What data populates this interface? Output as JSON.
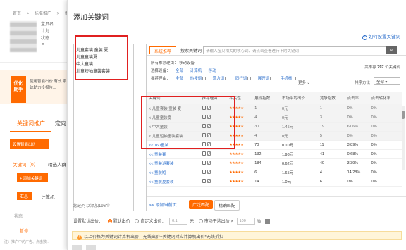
{
  "background": {
    "breadcrumb": [
      "首页",
      ">",
      "标准推广",
      ">",
      "推广"
    ],
    "info_lines": [
      "宝贝名：",
      "计划：",
      "状态：",
      "日："
    ],
    "promo_title": "优化助手",
    "promo_text": "使用智能出价 有效 系统助力投报告...",
    "tab_active": "关键词推广",
    "tab_other": "定向",
    "smart_btn": "设置智能出价",
    "kw_tab": "关键词（0）",
    "kw_tab_other": "精选人群",
    "add_kw_btn": "+ 添加关键词",
    "summary_btn": "汇总",
    "bid_label": "计算机",
    "status_label": "状态",
    "pause_label": "暂停",
    "note": "注：推广中的广告、点击数..."
  },
  "modal": {
    "title": "添加关键词",
    "help": "如何设置关键词",
    "selected_keywords": [
      "儿童套装 童装 夏",
      "儿童童装夏",
      "中大童装",
      "儿童短袖童装套装"
    ],
    "left_footer": "您还可以添加196个",
    "tabs": {
      "active": "系统推荐",
      "other": "搜索关键词"
    },
    "search_placeholder": "请输入宝贝相关的核心词、请点击查看进行下的关键词",
    "recommend_total_prefix": "共推荐",
    "recommend_total_count": "797",
    "recommend_total_suffix": "个关键词",
    "filters": {
      "all_reason_label": "所有推荐理由：",
      "all_reason_value": "移动设备",
      "device_label": "选择设备：",
      "device_options": [
        "全部",
        "计算机",
        "移动"
      ],
      "reason_label": "推荐理由：",
      "reason_options": [
        "全部",
        "热搜词",
        "潜力词",
        "同行词",
        "展开词",
        "手机标"
      ],
      "more": "更多",
      "sort_label": "排序方法：",
      "sort_value": "全部"
    },
    "table": {
      "headers": [
        "关键词",
        "推荐理由",
        "相关性",
        "展现指数",
        "市场平均出价",
        "竞争指数",
        "点击率",
        "点击转化率"
      ],
      "rows": [
        {
          "kw": "< 儿童套装 童装 夏",
          "stars": "★★★★★",
          "impr": "1",
          "avg": "0元",
          "comp": "1",
          "ctr": "0%",
          "cvr": "0%",
          "added": true
        },
        {
          "kw": "< 儿童童装夏",
          "stars": "★★★★★",
          "impr": "4",
          "avg": "0元",
          "comp": "3",
          "ctr": "0%",
          "cvr": "0%",
          "added": true
        },
        {
          "kw": "< 中大童装",
          "stars": "★★★★★",
          "impr": "30",
          "avg": "1.45元",
          "comp": "19",
          "ctr": "6.06%",
          "cvr": "0%",
          "added": true
        },
        {
          "kw": "< 儿童短袖童装套装",
          "stars": "★★★★★",
          "impr": "4",
          "avg": "0元",
          "comp": "5",
          "ctr": "0%",
          "cvr": "0%",
          "added": true
        },
        {
          "kw": "<< 160童装",
          "stars": "★★★★★",
          "impr": "70",
          "avg": "0.10元",
          "comp": "11",
          "ctr": "3.89%",
          "cvr": "0%",
          "added": false
        },
        {
          "kw": "<< 童装套",
          "stars": "★★★★★",
          "impr": "132",
          "avg": "1.98元",
          "comp": "41",
          "ctr": "0.68%",
          "cvr": "0%",
          "added": false
        },
        {
          "kw": "<< 童装运套装",
          "stars": "★★★★★",
          "impr": "184",
          "avg": "0.62元",
          "comp": "40",
          "ctr": "3.39%",
          "cvr": "0%",
          "added": false
        },
        {
          "kw": "<< 童装短",
          "stars": "★★★★★",
          "impr": "6",
          "avg": "1.65元",
          "comp": "4",
          "ctr": "14.28%",
          "cvr": "0%",
          "added": false
        },
        {
          "kw": "<< 童装夏套装",
          "stars": "★★★★★",
          "impr": "14",
          "avg": "1.0元",
          "comp": "6",
          "ctr": "0%",
          "cvr": "0%",
          "added": false
        }
      ]
    },
    "bottom": {
      "add_page": "<< 添加当前页",
      "btn_wide": "广泛匹配",
      "btn_exact": "精确匹配"
    },
    "bid": {
      "label": "设置默认出价：",
      "opt1": "默认出价",
      "opt2": "自定义出价：",
      "opt2_value": "0.1",
      "unit": "元",
      "opt3": "市场平均出价",
      "opt3_value": "100",
      "percent": "%"
    },
    "warning": "以上价格为关键词计算机出价，无线出价=关键词对应计算机出价*无线折扣"
  }
}
